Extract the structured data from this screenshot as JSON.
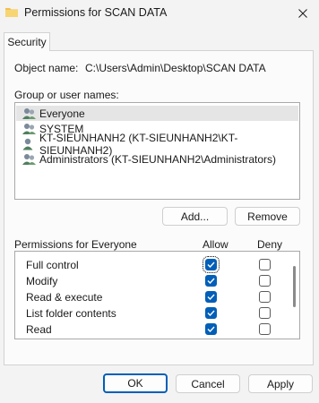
{
  "window": {
    "title": "Permissions for SCAN DATA"
  },
  "tabs": [
    {
      "label": "Security"
    }
  ],
  "object": {
    "label": "Object name:",
    "value": "C:\\Users\\Admin\\Desktop\\SCAN DATA"
  },
  "groups": {
    "label": "Group or user names:",
    "items": [
      {
        "name": "Everyone",
        "icon": "group-icon",
        "selected": true
      },
      {
        "name": "SYSTEM",
        "icon": "group-icon",
        "selected": false
      },
      {
        "name": "KT-SIEUNHANH2 (KT-SIEUNHANH2\\KT-SIEUNHANH2)",
        "icon": "user-icon",
        "selected": false
      },
      {
        "name": "Administrators (KT-SIEUNHANH2\\Administrators)",
        "icon": "group-icon",
        "selected": false
      }
    ],
    "add_label": "Add...",
    "remove_label": "Remove"
  },
  "permissions": {
    "header": "Permissions for Everyone",
    "allow_header": "Allow",
    "deny_header": "Deny",
    "rows": [
      {
        "name": "Full control",
        "allow": true,
        "deny": false
      },
      {
        "name": "Modify",
        "allow": true,
        "deny": false
      },
      {
        "name": "Read & execute",
        "allow": true,
        "deny": false
      },
      {
        "name": "List folder contents",
        "allow": true,
        "deny": false
      },
      {
        "name": "Read",
        "allow": true,
        "deny": false
      },
      {
        "name": "",
        "allow": true,
        "deny": false
      }
    ]
  },
  "footer": {
    "ok_label": "OK",
    "cancel_label": "Cancel",
    "apply_label": "Apply"
  },
  "colors": {
    "accent": "#005fb8",
    "selection": "#e5e5e5",
    "folder": "#f2c14e"
  }
}
